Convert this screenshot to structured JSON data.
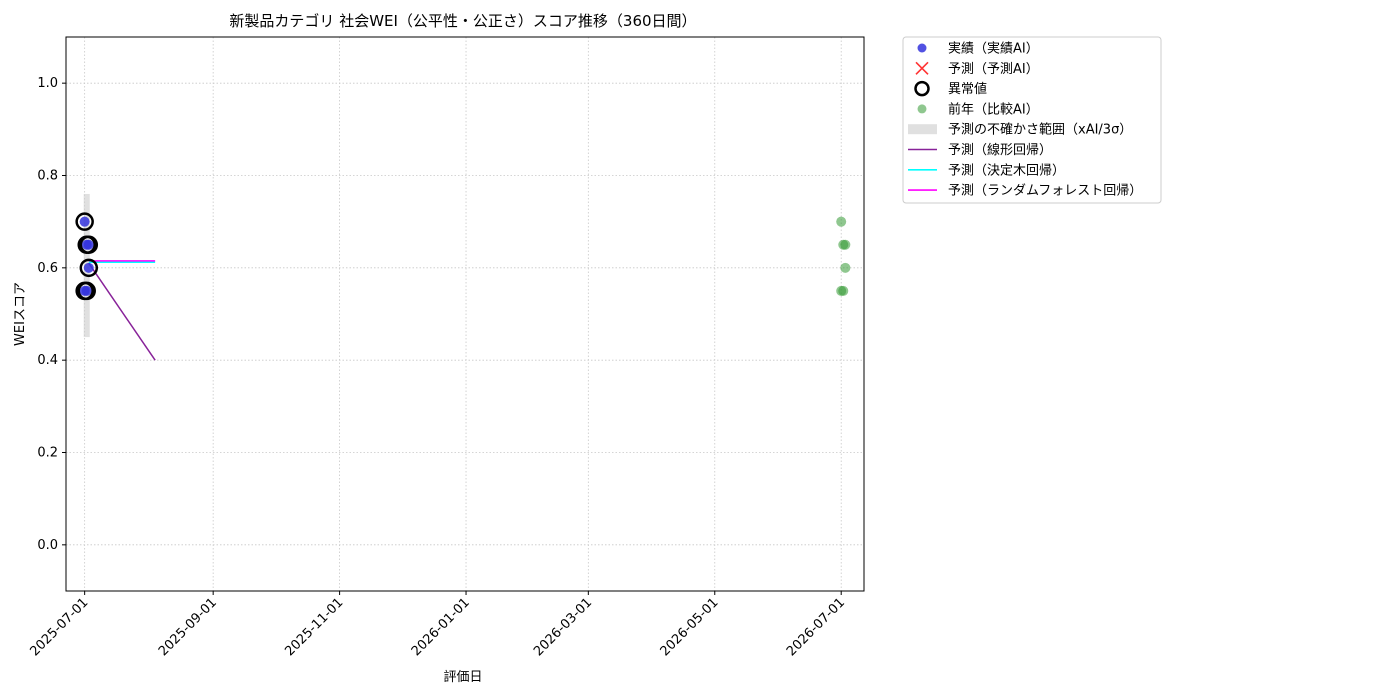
{
  "chart_data": {
    "type": "scatter",
    "title": "新製品カテゴリ 社会WEI（公平性・公正さ）スコア推移（360日間）",
    "xlabel": "評価日",
    "ylabel": "WEIスコア",
    "xlim": [
      "2025-06-22",
      "2026-07-12"
    ],
    "ylim": [
      -0.1,
      1.1
    ],
    "grid": true,
    "grid_style": "dotted",
    "legend_position": "outside-right-top",
    "x_ticks": [
      "2025-07-01",
      "2025-09-01",
      "2025-11-01",
      "2026-01-01",
      "2026-03-01",
      "2026-05-01",
      "2026-07-01"
    ],
    "y_ticks": [
      0.0,
      0.2,
      0.4,
      0.6,
      0.8,
      1.0
    ],
    "y_tick_labels": [
      "0.0",
      "0.2",
      "0.4",
      "0.6",
      "0.8",
      "1.0"
    ],
    "series": [
      {
        "name": "実績（実績AI）",
        "kind": "scatter",
        "color": "#3333dd",
        "points": [
          {
            "x": "2025-07-01",
            "y": 0.7
          },
          {
            "x": "2025-07-01",
            "y": 0.55
          },
          {
            "x": "2025-07-02",
            "y": 0.65
          },
          {
            "x": "2025-07-02",
            "y": 0.55
          },
          {
            "x": "2025-07-03",
            "y": 0.65
          },
          {
            "x": "2025-07-03",
            "y": 0.6
          }
        ]
      },
      {
        "name": "予測（予測AI）",
        "kind": "x-marker",
        "color": "#ff3333",
        "points": []
      },
      {
        "name": "異常値",
        "kind": "ring",
        "color": "#000000",
        "points": [
          {
            "x": "2025-07-01",
            "y": 0.7
          },
          {
            "x": "2025-07-01",
            "y": 0.55
          },
          {
            "x": "2025-07-02",
            "y": 0.65
          },
          {
            "x": "2025-07-02",
            "y": 0.55
          },
          {
            "x": "2025-07-03",
            "y": 0.65
          },
          {
            "x": "2025-07-03",
            "y": 0.6
          }
        ]
      },
      {
        "name": "前年（比較AI）",
        "kind": "scatter",
        "color": "#339933",
        "points": [
          {
            "x": "2026-07-01",
            "y": 0.7
          },
          {
            "x": "2026-07-01",
            "y": 0.55
          },
          {
            "x": "2026-07-02",
            "y": 0.65
          },
          {
            "x": "2026-07-02",
            "y": 0.55
          },
          {
            "x": "2026-07-03",
            "y": 0.65
          },
          {
            "x": "2026-07-03",
            "y": 0.6
          }
        ]
      },
      {
        "name": "予測の不確かさ範囲（xAI/3σ）",
        "kind": "band",
        "color": "#cccccc",
        "x_from": "2025-07-01",
        "x_to": "2025-07-03",
        "y_low": 0.45,
        "y_high": 0.76
      },
      {
        "name": "予測（線形回帰）",
        "kind": "line",
        "color": "#882299",
        "points": [
          {
            "x": "2025-07-03",
            "y": 0.61
          },
          {
            "x": "2025-08-04",
            "y": 0.4
          }
        ]
      },
      {
        "name": "予測（決定木回帰）",
        "kind": "line",
        "color": "#00ffff",
        "points": [
          {
            "x": "2025-07-03",
            "y": 0.612
          },
          {
            "x": "2025-08-04",
            "y": 0.612
          }
        ]
      },
      {
        "name": "予測（ランダムフォレスト回帰）",
        "kind": "line",
        "color": "#ff00ff",
        "points": [
          {
            "x": "2025-07-03",
            "y": 0.615
          },
          {
            "x": "2025-08-04",
            "y": 0.615
          }
        ]
      }
    ]
  }
}
